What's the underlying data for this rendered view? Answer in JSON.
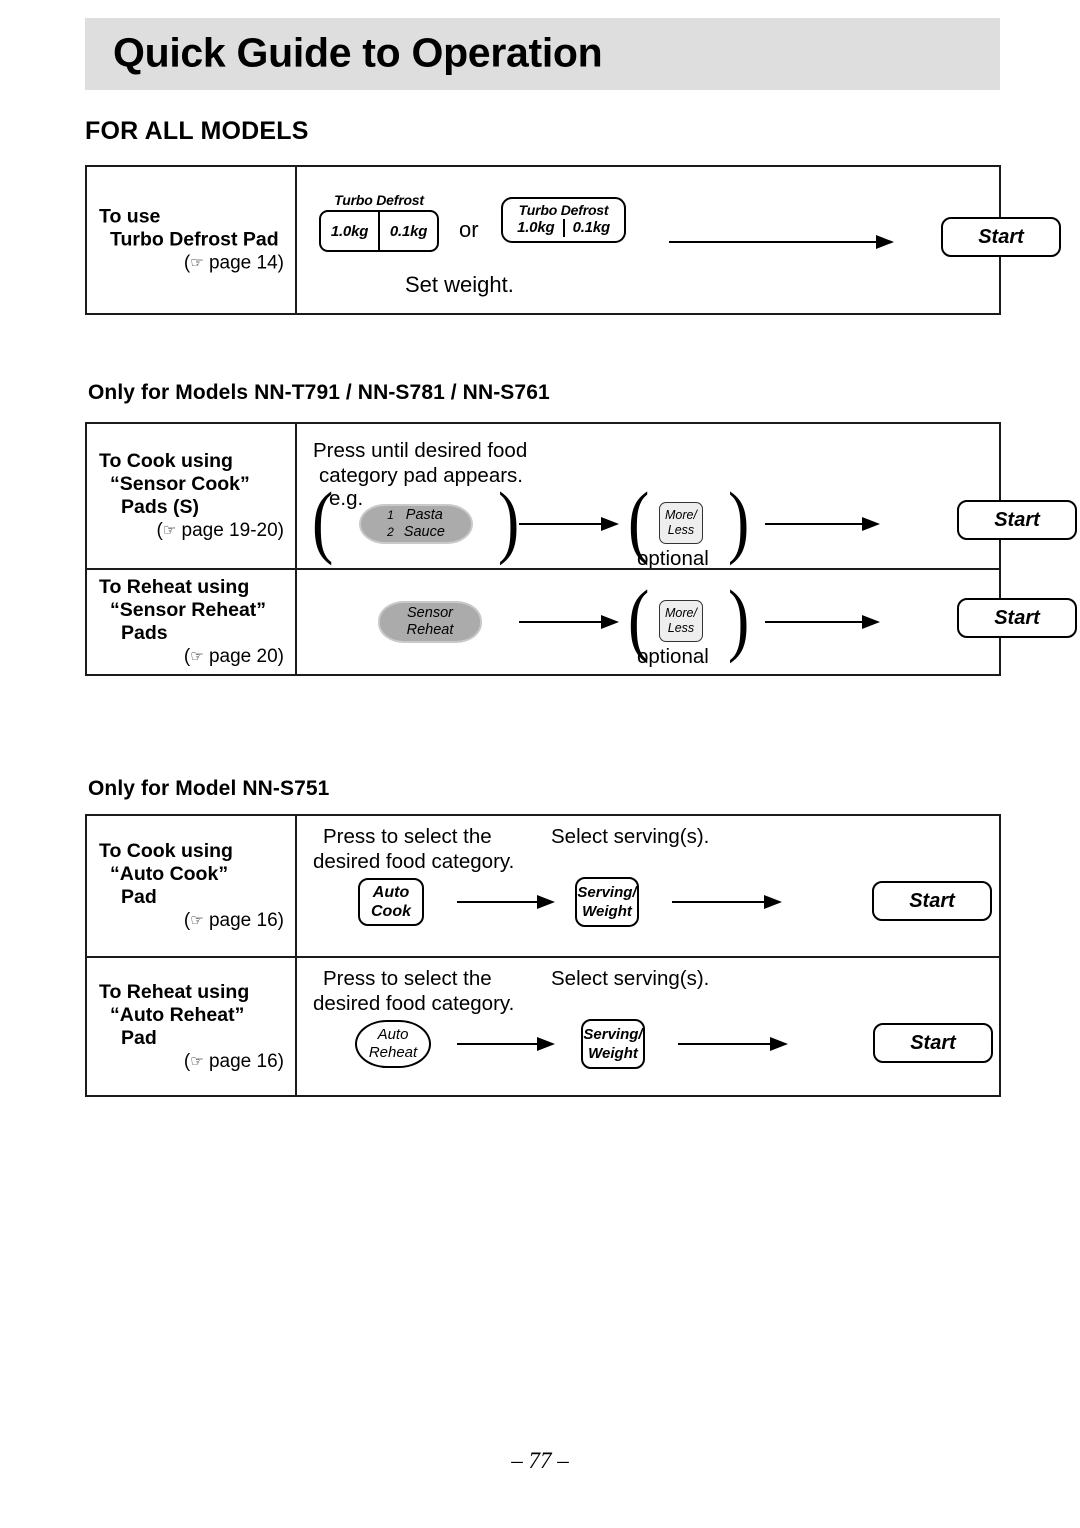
{
  "header": {
    "title": "Quick Guide to Operation"
  },
  "sections": {
    "all_models": "FOR ALL MODELS",
    "models_t791": "Only for Models NN-T791 / NN-S781 / NN-S761",
    "model_s751": "Only for Model NN-S751"
  },
  "icons": {
    "hand": "☞"
  },
  "rows": {
    "turbo_defrost": {
      "label_line1": "To use",
      "label_line2": "Turbo Defrost Pad",
      "page_ref": "page 14",
      "pad_a": {
        "caption": "Turbo Defrost",
        "cell1": "1.0kg",
        "cell2": "0.1kg"
      },
      "or_text": "or",
      "pad_b": {
        "caption": "Turbo Defrost",
        "cell1": "1.0kg",
        "cell2": "0.1kg"
      },
      "caption_below": "Set weight.",
      "start": "Start"
    },
    "sensor_cook": {
      "label_line1": "To Cook using",
      "label_line2": "“Sensor Cook”",
      "label_line3": "Pads (S)",
      "page_ref": "page 19-20",
      "instruction_line1": "Press until desired food",
      "instruction_line2": "category pad appears.",
      "eg": "e.g.",
      "category_pad": {
        "num1": "1",
        "num2": "2",
        "text1": "Pasta",
        "text2": "Sauce"
      },
      "moreless": {
        "line1": "More/",
        "line2": "Less"
      },
      "optional": "optional",
      "start": "Start"
    },
    "sensor_reheat": {
      "label_line1": "To Reheat using",
      "label_line2": "“Sensor Reheat”",
      "label_line3": "Pads",
      "page_ref": "page 20",
      "sensor_pad": {
        "line1": "Sensor",
        "line2": "Reheat"
      },
      "moreless": {
        "line1": "More/",
        "line2": "Less"
      },
      "optional": "optional",
      "start": "Start"
    },
    "auto_cook": {
      "label_line1": "To Cook using",
      "label_line2": "“Auto Cook”",
      "label_line3": "Pad",
      "page_ref": "page 16",
      "instruction_line1": "Press to select the",
      "instruction_line2": "desired food category.",
      "serving_note": "Select serving(s).",
      "pad": {
        "line1": "Auto",
        "line2": "Cook"
      },
      "serving_pad": {
        "line1": "Serving/",
        "line2": "Weight"
      },
      "start": "Start"
    },
    "auto_reheat": {
      "label_line1": "To Reheat using",
      "label_line2": "“Auto Reheat”",
      "label_line3": "Pad",
      "page_ref": "page 16",
      "instruction_line1": "Press to select the",
      "instruction_line2": "desired food category.",
      "serving_note": "Select serving(s).",
      "pad": {
        "line1": "Auto",
        "line2": "Reheat"
      },
      "serving_pad": {
        "line1": "Serving/",
        "line2": "Weight"
      },
      "start": "Start"
    }
  },
  "footer": {
    "page_number": "– 77 –"
  },
  "colors": {
    "header_band": "#dedede",
    "gray_pad": "#ababab",
    "light_pad": "#eeeeee",
    "rule": "#1b1b1b"
  }
}
